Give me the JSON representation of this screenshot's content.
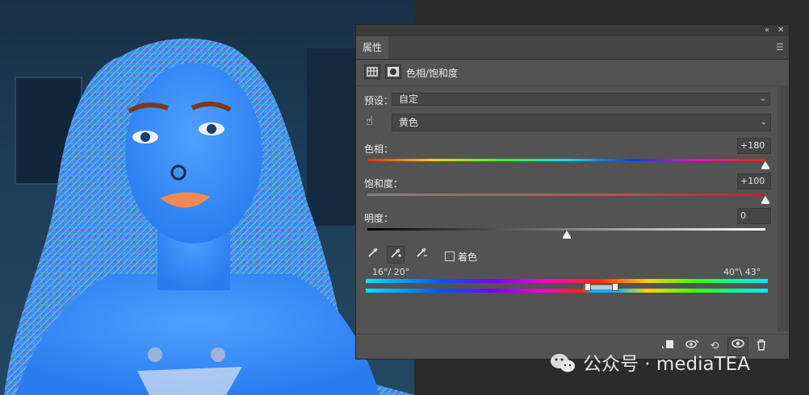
{
  "panel": {
    "tab_label": "属性",
    "collapse_icon": "double-chevron-left-icon",
    "close_icon": "close-icon",
    "menu_icon": "panel-menu-icon",
    "adjustment_title": "色相/饱和度",
    "preset_label": "预设：",
    "preset_value": "自定",
    "channel_value": "黄色",
    "hue_label": "色相：",
    "hue_value": "+180",
    "saturation_label": "饱和度：",
    "saturation_value": "+100",
    "lightness_label": "明度：",
    "lightness_value": "0",
    "colorize_label": "着色",
    "colorize_checked": false,
    "range_left": "16°/ 20°",
    "range_right": "40°\\ 43°"
  },
  "sliders": {
    "hue_fraction": 1.0,
    "saturation_fraction": 1.0,
    "lightness_fraction": 0.5
  },
  "bottom_icons": [
    "clip-to-layer-icon",
    "view-previous-state-icon",
    "reset-icon",
    "visibility-eye-icon",
    "delete-icon"
  ],
  "colors": {
    "panel_bg": "#535353",
    "slider_thumb": "#f2f2f2"
  },
  "watermark": {
    "text": "公众号 · mediaTEA"
  }
}
